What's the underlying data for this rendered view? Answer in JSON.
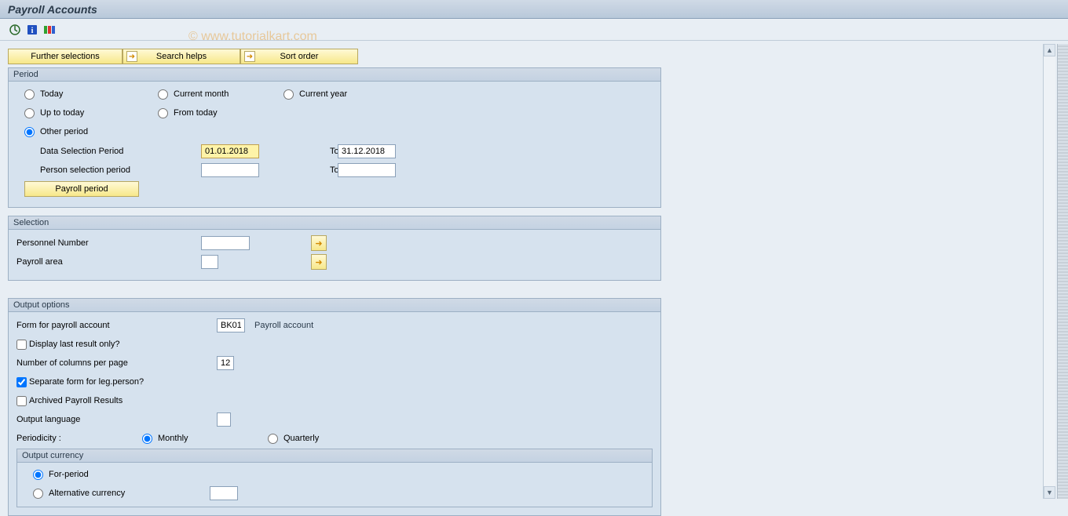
{
  "title": "Payroll Accounts",
  "watermark": "© www.tutorialkart.com",
  "toolbar_icons": [
    "execute-icon",
    "info-icon",
    "variant-icon"
  ],
  "button_row": {
    "further_selections": "Further selections",
    "search_helps": "Search helps",
    "sort_order": "Sort order"
  },
  "period": {
    "title": "Period",
    "radios": {
      "today": "Today",
      "current_month": "Current month",
      "current_year": "Current year",
      "up_to_today": "Up to today",
      "from_today": "From today",
      "other_period": "Other period"
    },
    "selected": "other_period",
    "data_selection_label": "Data Selection Period",
    "data_selection_from": "01.01.2018",
    "data_selection_to": "31.12.2018",
    "person_selection_label": "Person selection period",
    "person_selection_from": "",
    "person_selection_to": "",
    "to_label": "To",
    "payroll_period_btn": "Payroll period"
  },
  "selection": {
    "title": "Selection",
    "personnel_number_label": "Personnel Number",
    "personnel_number_value": "",
    "payroll_area_label": "Payroll area",
    "payroll_area_value": ""
  },
  "output": {
    "title": "Output options",
    "form_label": "Form for payroll account",
    "form_value": "BK01",
    "form_desc": "Payroll account",
    "display_last_label": "Display last result only?",
    "display_last_checked": false,
    "num_cols_label": "Number of columns per page",
    "num_cols_value": "12",
    "separate_form_label": "Separate form for leg.person?",
    "separate_form_checked": true,
    "archived_label": "Archived Payroll Results",
    "archived_checked": false,
    "output_lang_label": "Output language",
    "output_lang_value": "",
    "periodicity_label": "Periodicity :",
    "periodicity_monthly": "Monthly",
    "periodicity_quarterly": "Quarterly",
    "periodicity_selected": "monthly",
    "currency": {
      "title": "Output currency",
      "for_period": "For-period",
      "alternative": "Alternative currency",
      "alternative_value": "",
      "selected": "for_period"
    }
  }
}
